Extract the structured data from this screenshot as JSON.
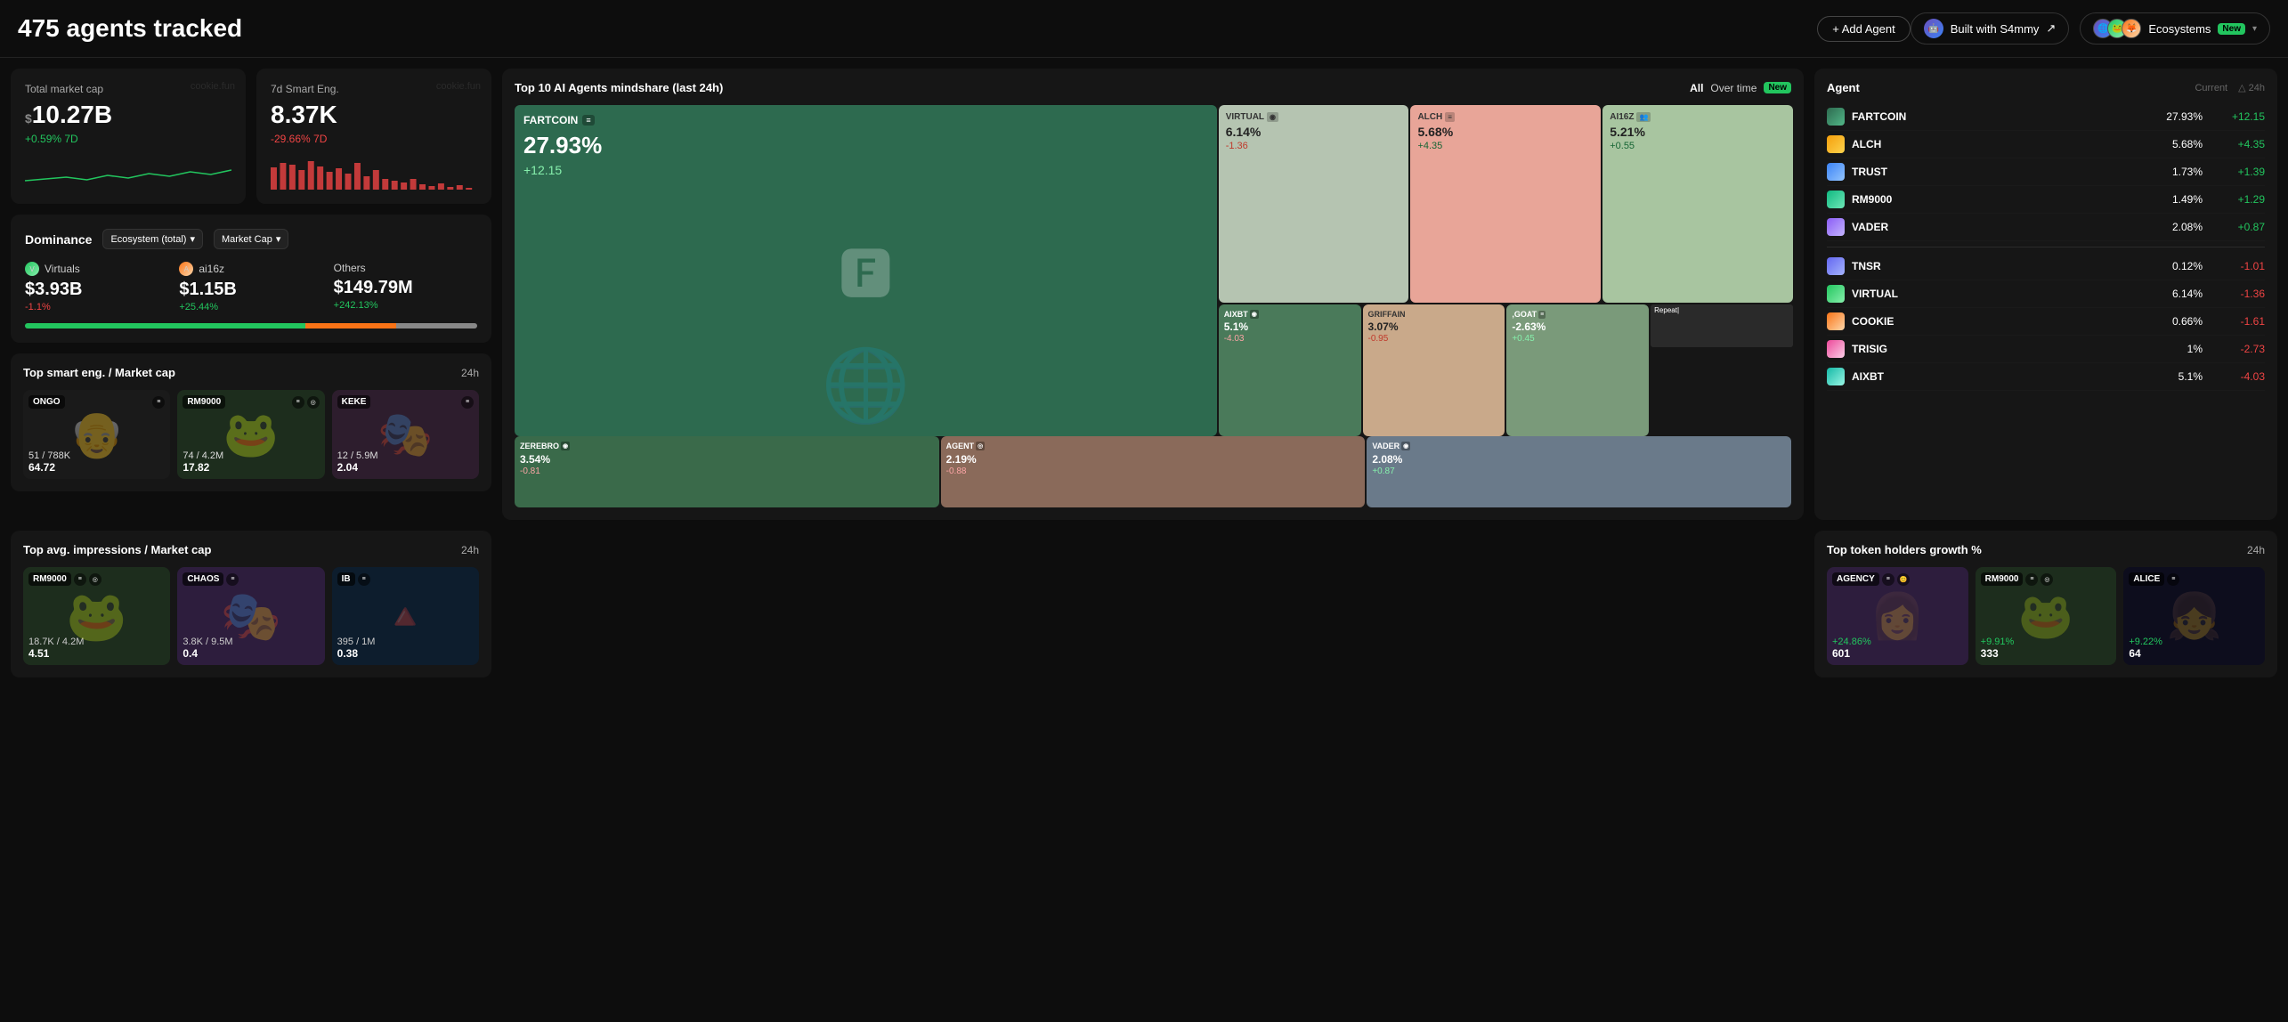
{
  "header": {
    "title": "475 agents tracked",
    "add_agent_label": "+ Add Agent",
    "built_with_label": "Built with S4mmy",
    "built_with_arrow": "↗",
    "ecosystems_label": "Ecosystems",
    "ecosystems_badge": "New"
  },
  "stats": {
    "market_cap_label": "Total market cap",
    "market_cap_value": "10.27B",
    "market_cap_change": "+0.59% 7D",
    "smart_eng_label": "7d Smart Eng.",
    "smart_eng_value": "8.37K",
    "smart_eng_change": "-29.66% 7D",
    "watermark": "cookie.fun"
  },
  "dominance": {
    "title": "Dominance",
    "filter1": "Ecosystem (total)",
    "filter2": "Market Cap",
    "virtuals_label": "Virtuals",
    "virtuals_value": "$3.93B",
    "virtuals_change": "-1.1%",
    "ai16z_label": "ai16z",
    "ai16z_value": "$1.15B",
    "ai16z_change": "+25.44%",
    "others_label": "Others",
    "others_value": "$149.79M",
    "others_change": "+242.13%"
  },
  "mindshare": {
    "title": "Top 10 AI Agents mindshare (last 24h)",
    "filter_all": "All",
    "filter_overtime": "Over time",
    "badge_new": "New",
    "leaderboard_title": "Agent",
    "col_current": "Current",
    "col_24h": "△ 24h",
    "agents": [
      {
        "name": "FARTCOIN",
        "current": "27.93%",
        "change": "+12.15",
        "pos": true
      },
      {
        "name": "ALCH",
        "current": "5.68%",
        "change": "+4.35",
        "pos": true
      },
      {
        "name": "TRUST",
        "current": "1.73%",
        "change": "+1.39",
        "pos": true
      },
      {
        "name": "RM9000",
        "current": "1.49%",
        "change": "+1.29",
        "pos": true
      },
      {
        "name": "VADER",
        "current": "2.08%",
        "change": "+0.87",
        "pos": true
      },
      {
        "name": "TNSR",
        "current": "0.12%",
        "change": "-1.01",
        "pos": false
      },
      {
        "name": "VIRTUAL",
        "current": "6.14%",
        "change": "-1.36",
        "pos": false
      },
      {
        "name": "COOKIE",
        "current": "0.66%",
        "change": "-1.61",
        "pos": false
      },
      {
        "name": "TRISIG",
        "current": "1%",
        "change": "-2.73",
        "pos": false
      },
      {
        "name": "AIXBT",
        "current": "5.1%",
        "change": "-4.03",
        "pos": false
      }
    ],
    "treemap": [
      {
        "name": "FARTCOIN",
        "pct": "27.93%",
        "change": "+12.15",
        "pos": true,
        "size": "large"
      },
      {
        "name": "VIRTUAL",
        "pct": "6.14%",
        "change": "-1.36",
        "pos": false
      },
      {
        "name": "ALCH",
        "pct": "5.68%",
        "change": "+4.35",
        "pos": true
      },
      {
        "name": "AI16Z",
        "pct": "5.21%",
        "change": "+0.55",
        "pos": true
      },
      {
        "name": "AIXBT",
        "pct": "5.1%",
        "change": "-4.03",
        "pos": false
      },
      {
        "name": "GRIFFAIN",
        "pct": "3.07%",
        "change": "-0.95",
        "pos": false
      },
      {
        "name": "GOAT",
        "pct": "-2.63%",
        "change": "+0.45",
        "pos": true
      },
      {
        "name": "ZEREBRO",
        "pct": "3.54%",
        "change": "-0.81",
        "pos": false
      },
      {
        "name": "AGENT",
        "pct": "2.19%",
        "change": "-0.88",
        "pos": false
      },
      {
        "name": "VADER",
        "pct": "2.08%",
        "change": "+0.87",
        "pos": true
      }
    ]
  },
  "smart_eng_section": {
    "title": "Top smart eng. / Market cap",
    "time": "24h",
    "cards": [
      {
        "name": "ONGO",
        "stat1": "51 / 788K",
        "stat2": "64.72",
        "bg": "#2a2a2a"
      },
      {
        "name": "RM9000",
        "stat1": "74 / 4.2M",
        "stat2": "17.82",
        "bg": "#3a4a3a"
      },
      {
        "name": "KEKE",
        "stat1": "12 / 5.9M",
        "stat2": "2.04",
        "bg": "#4a3a4a"
      }
    ]
  },
  "impressions_section": {
    "title": "Top avg. impressions / Market cap",
    "time": "24h",
    "cards": [
      {
        "name": "RM9000",
        "stat1": "18.7K / 4.2M",
        "stat2": "4.51",
        "bg": "#3a4a3a"
      },
      {
        "name": "CHAOS",
        "stat1": "3.8K / 9.5M",
        "stat2": "0.4",
        "bg": "#4a3a5a"
      },
      {
        "name": "IB",
        "stat1": "395 / 1M",
        "stat2": "0.38",
        "bg": "#1a2a3a"
      }
    ]
  },
  "holders_section": {
    "title": "Top token holders growth %",
    "time": "24h",
    "cards": [
      {
        "name": "AGENCY",
        "stat1": "+24.86%",
        "stat2": "601",
        "bg": "#3a2a4a"
      },
      {
        "name": "RM9000",
        "stat1": "+9.91%",
        "stat2": "333",
        "bg": "#3a4a3a"
      },
      {
        "name": "ALICE",
        "stat1": "+9.22%",
        "stat2": "64",
        "bg": "#1a1a2a"
      }
    ]
  }
}
